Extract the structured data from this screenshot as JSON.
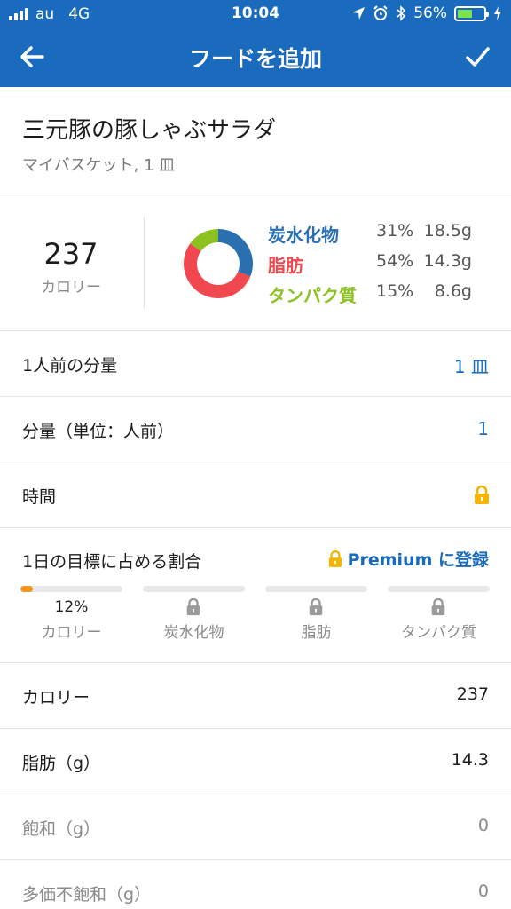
{
  "status_bar": {
    "carrier": "au",
    "network": "4G",
    "time": "10:04",
    "battery": "56%",
    "battery_level": 0.56
  },
  "header": {
    "title": "フードを追加",
    "back_icon": "arrow-left-icon",
    "confirm_icon": "checkmark-icon"
  },
  "food": {
    "name": "三元豚の豚しゃぶサラダ",
    "meta": "マイバスケット, 1 皿"
  },
  "summary": {
    "calories": "237",
    "calories_label": "カロリー",
    "macros": [
      {
        "name": "炭水化物",
        "percent": "31%",
        "grams": "18.5g",
        "color": "#2a6fb0",
        "share": 31
      },
      {
        "name": "脂肪",
        "percent": "54%",
        "grams": "14.3g",
        "color": "#f0484e",
        "share": 54
      },
      {
        "name": "タンパク質",
        "percent": "15%",
        "grams": "8.6g",
        "color": "#8cc21f",
        "share": 15
      }
    ]
  },
  "rows": {
    "serving_size_label": "1人前の分量",
    "serving_size_value": "1 皿",
    "servings_label": "分量（単位：人前）",
    "servings_value": "1",
    "time_label": "時間"
  },
  "goal": {
    "label": "1日の目標に占める割合",
    "premium_label": "Premium に登録",
    "columns": [
      {
        "name": "カロリー",
        "value": "12%",
        "fraction": 0.12,
        "locked": false
      },
      {
        "name": "炭水化物",
        "value": "",
        "fraction": 0,
        "locked": true
      },
      {
        "name": "脂肪",
        "value": "",
        "fraction": 0,
        "locked": true
      },
      {
        "name": "タンパク質",
        "value": "",
        "fraction": 0,
        "locked": true
      }
    ]
  },
  "nutrients": [
    {
      "label": "カロリー",
      "value": "237",
      "muted": false
    },
    {
      "label": "脂肪（g）",
      "value": "14.3",
      "muted": false
    },
    {
      "label": "飽和（g）",
      "value": "0",
      "muted": true
    },
    {
      "label": "多価不飽和（g）",
      "value": "0",
      "muted": true
    }
  ],
  "colors": {
    "brand_blue": "#1a6bbd",
    "progress_orange": "#f7941d",
    "lock_gold": "#f4b400"
  }
}
